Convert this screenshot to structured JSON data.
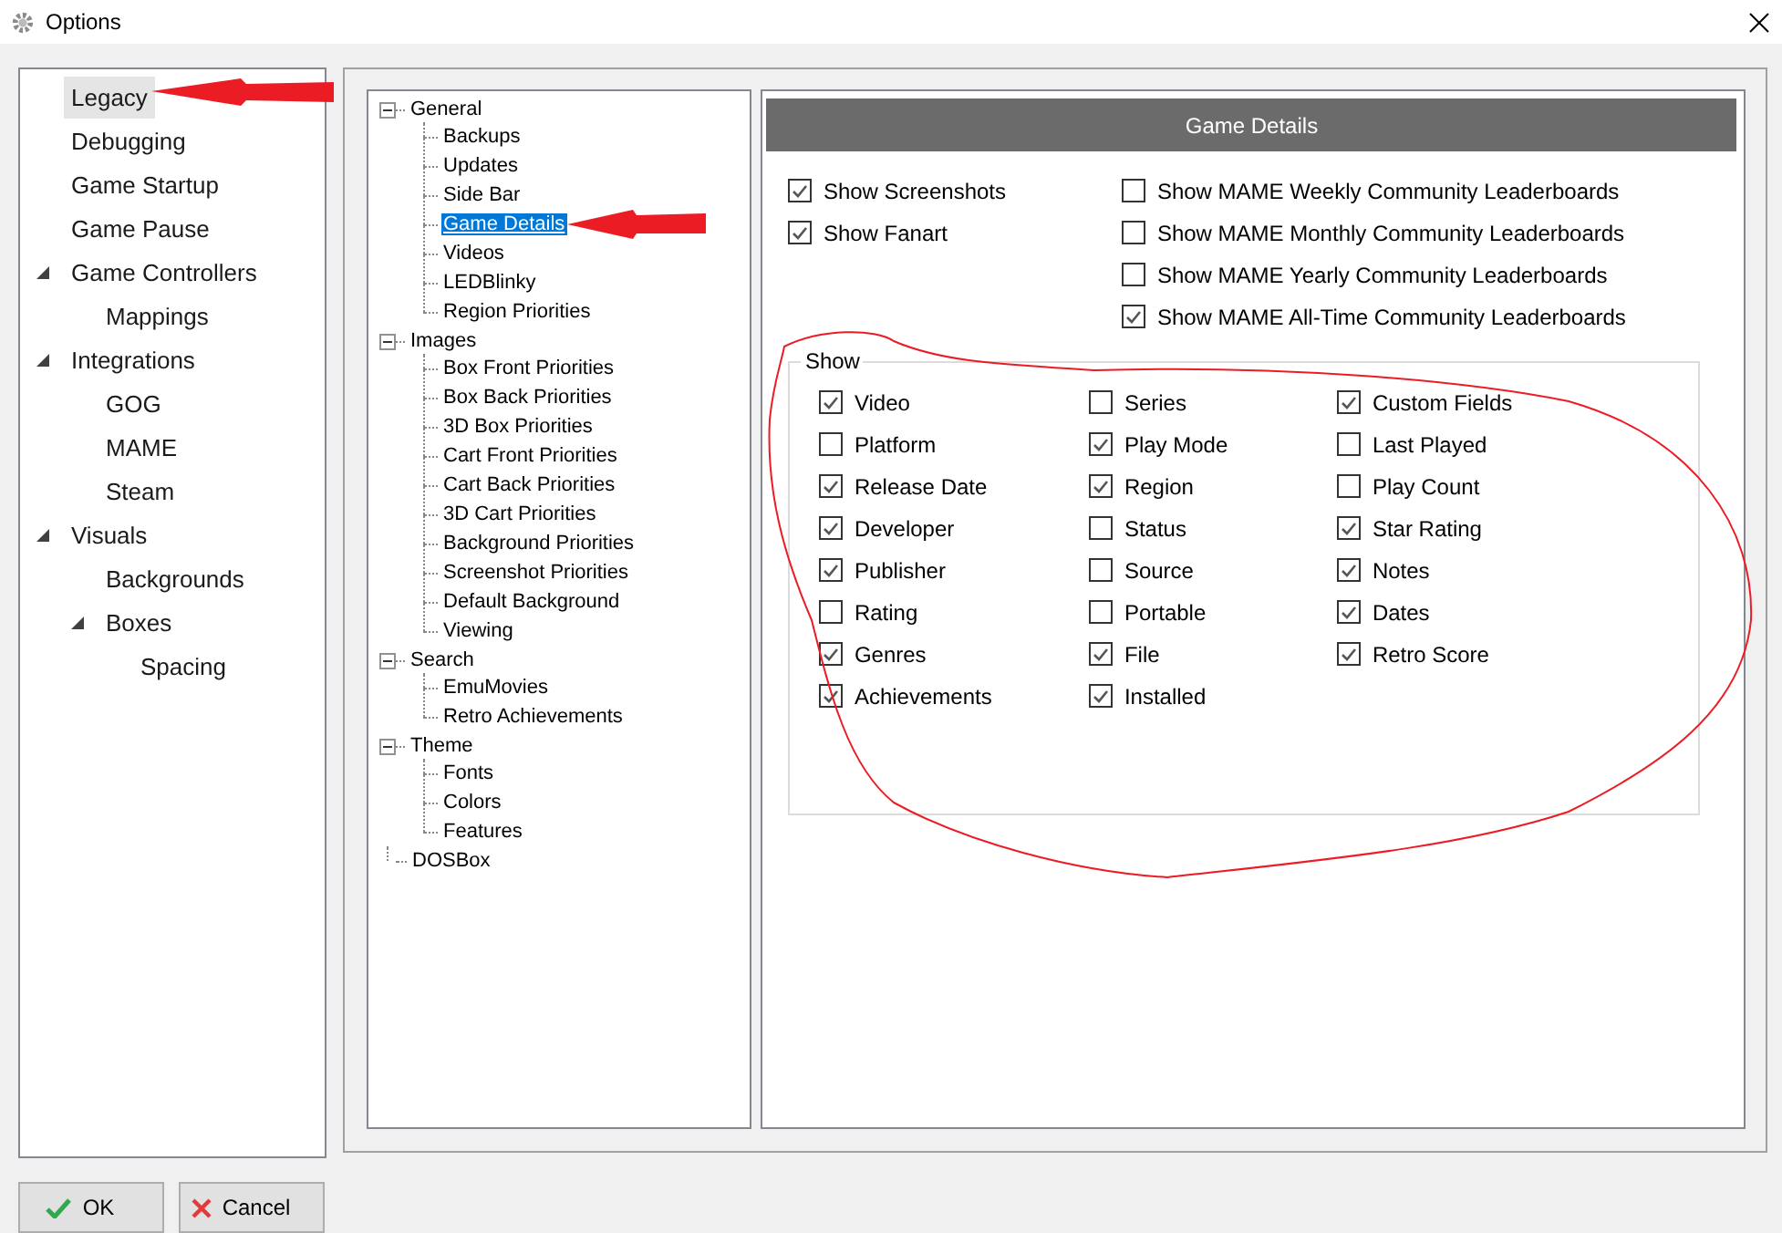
{
  "window": {
    "title": "Options"
  },
  "nav": [
    {
      "label": "Legacy",
      "selected": true
    },
    {
      "label": "Debugging",
      "selected": false
    },
    {
      "label": "Game Startup",
      "selected": false
    },
    {
      "label": "Game Pause",
      "selected": false
    },
    {
      "label": "Game Controllers",
      "selected": false,
      "expanded": true,
      "children": [
        {
          "label": "Mappings",
          "selected": false
        }
      ]
    },
    {
      "label": "Integrations",
      "selected": false,
      "expanded": true,
      "children": [
        {
          "label": "GOG",
          "selected": false
        },
        {
          "label": "MAME",
          "selected": false
        },
        {
          "label": "Steam",
          "selected": false
        }
      ]
    },
    {
      "label": "Visuals",
      "selected": false,
      "expanded": true,
      "children": [
        {
          "label": "Backgrounds",
          "selected": false
        },
        {
          "label": "Boxes",
          "selected": false,
          "expanded": true,
          "children": [
            {
              "label": "Spacing",
              "selected": false
            }
          ]
        }
      ]
    }
  ],
  "tree": [
    {
      "label": "General",
      "expanded": true,
      "children": [
        {
          "label": "Backups",
          "selected": false
        },
        {
          "label": "Updates",
          "selected": false
        },
        {
          "label": "Side Bar",
          "selected": false
        },
        {
          "label": "Game Details",
          "selected": true
        },
        {
          "label": "Videos",
          "selected": false
        },
        {
          "label": "LEDBlinky",
          "selected": false
        },
        {
          "label": "Region Priorities",
          "selected": false
        }
      ]
    },
    {
      "label": "Images",
      "expanded": true,
      "children": [
        {
          "label": "Box Front Priorities",
          "selected": false
        },
        {
          "label": "Box Back Priorities",
          "selected": false
        },
        {
          "label": "3D Box Priorities",
          "selected": false
        },
        {
          "label": "Cart Front Priorities",
          "selected": false
        },
        {
          "label": "Cart Back Priorities",
          "selected": false
        },
        {
          "label": "3D Cart Priorities",
          "selected": false
        },
        {
          "label": "Background Priorities",
          "selected": false
        },
        {
          "label": "Screenshot Priorities",
          "selected": false
        },
        {
          "label": "Default Background",
          "selected": false
        },
        {
          "label": "Viewing",
          "selected": false
        }
      ]
    },
    {
      "label": "Search",
      "expanded": true,
      "children": [
        {
          "label": "EmuMovies",
          "selected": false
        },
        {
          "label": "Retro Achievements",
          "selected": false
        }
      ]
    },
    {
      "label": "Theme",
      "expanded": true,
      "children": [
        {
          "label": "Fonts",
          "selected": false
        },
        {
          "label": "Colors",
          "selected": false
        },
        {
          "label": "Features",
          "selected": false
        }
      ]
    },
    {
      "label": "DOSBox"
    }
  ],
  "panel": {
    "title": "Game Details",
    "left_options": [
      {
        "label": "Show Screenshots",
        "checked": true
      },
      {
        "label": "Show Fanart",
        "checked": true
      }
    ],
    "right_options": [
      {
        "label": "Show MAME Weekly Community Leaderboards",
        "checked": false
      },
      {
        "label": "Show MAME Monthly Community Leaderboards",
        "checked": false
      },
      {
        "label": "Show MAME Yearly Community Leaderboards",
        "checked": false
      },
      {
        "label": "Show MAME All-Time Community Leaderboards",
        "checked": true
      }
    ],
    "show_group": {
      "title": "Show",
      "columns": [
        [
          {
            "label": "Video",
            "checked": true
          },
          {
            "label": "Platform",
            "checked": false
          },
          {
            "label": "Release Date",
            "checked": true
          },
          {
            "label": "Developer",
            "checked": true
          },
          {
            "label": "Publisher",
            "checked": true
          },
          {
            "label": "Rating",
            "checked": false
          },
          {
            "label": "Genres",
            "checked": true
          },
          {
            "label": "Achievements",
            "checked": true
          }
        ],
        [
          {
            "label": "Series",
            "checked": false
          },
          {
            "label": "Play Mode",
            "checked": true
          },
          {
            "label": "Region",
            "checked": true
          },
          {
            "label": "Status",
            "checked": false
          },
          {
            "label": "Source",
            "checked": false
          },
          {
            "label": "Portable",
            "checked": false
          },
          {
            "label": "File",
            "checked": true
          },
          {
            "label": "Installed",
            "checked": true
          }
        ],
        [
          {
            "label": "Custom Fields",
            "checked": true
          },
          {
            "label": "Last Played",
            "checked": false
          },
          {
            "label": "Play Count",
            "checked": false
          },
          {
            "label": "Star Rating",
            "checked": true
          },
          {
            "label": "Notes",
            "checked": true
          },
          {
            "label": "Dates",
            "checked": true
          },
          {
            "label": "Retro Score",
            "checked": true
          }
        ]
      ]
    }
  },
  "buttons": [
    {
      "kind": "ok",
      "label": "OK"
    },
    {
      "kind": "cancel",
      "label": "Cancel"
    }
  ]
}
